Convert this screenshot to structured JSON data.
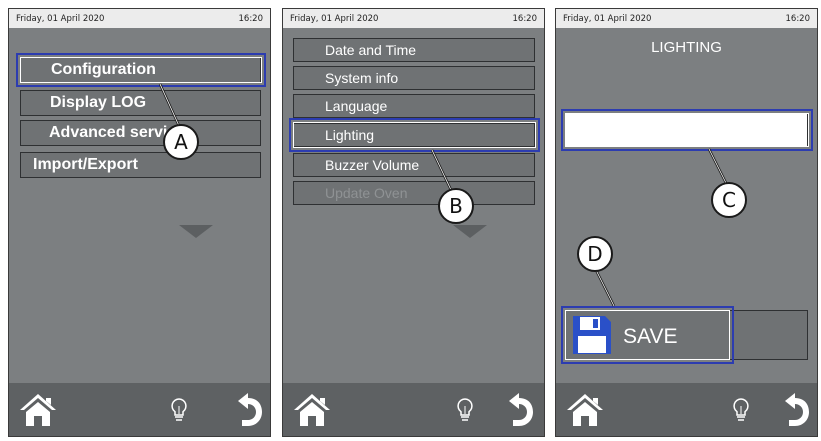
{
  "screens": [
    {
      "status": {
        "date": "Friday, 01 April 2020",
        "time": "16:20"
      },
      "menu": [
        {
          "label": "Configuration"
        },
        {
          "label": "Display LOG"
        },
        {
          "label": "Advanced services"
        },
        {
          "label": "Import/Export"
        }
      ],
      "callout": "A"
    },
    {
      "status": {
        "date": "Friday, 01 April 2020",
        "time": "16:20"
      },
      "menu": [
        {
          "label": "Date and Time"
        },
        {
          "label": "System info"
        },
        {
          "label": "Language"
        },
        {
          "label": "Lighting"
        },
        {
          "label": "Buzzer Volume"
        },
        {
          "label": "Update Oven",
          "disabled": true
        }
      ],
      "callout": "B"
    },
    {
      "status": {
        "date": "Friday, 01 April 2020",
        "time": "16:20"
      },
      "title": "LIGHTING",
      "save_label": "SAVE",
      "callouts": [
        "C",
        "D"
      ]
    }
  ],
  "footer_icons": [
    "home-icon",
    "lightbulb-icon",
    "back-icon"
  ],
  "colors": {
    "screen_bg": "#7c7f81",
    "footer_bg": "#5e6163",
    "highlight": "#2c3cb0",
    "save_icon": "#2a50c8"
  }
}
